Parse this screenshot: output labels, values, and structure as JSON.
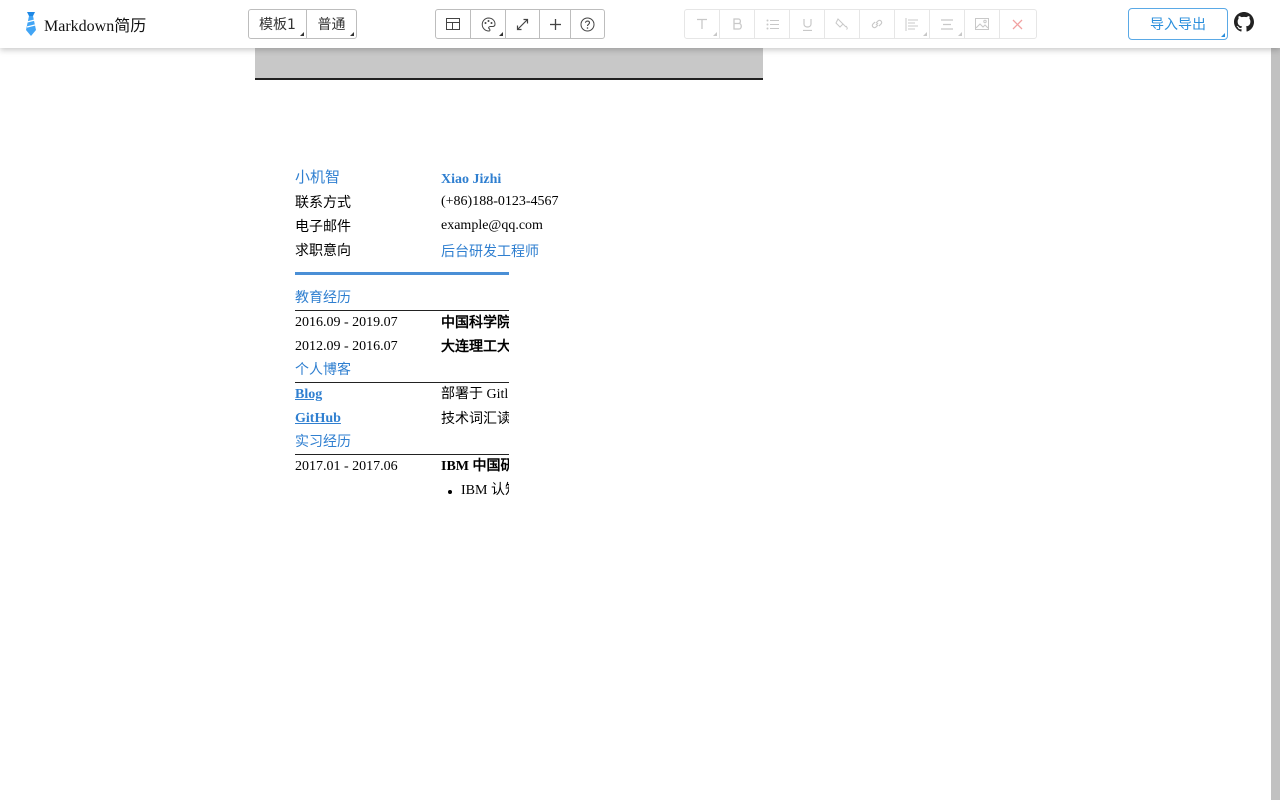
{
  "app": {
    "title": "Markdown简历"
  },
  "toolbar": {
    "template_button": "模板1",
    "mode_button": "普通",
    "view_icons": [
      "table-icon",
      "palette-icon",
      "expand-icon",
      "plus-icon",
      "help-icon"
    ],
    "format_icons": [
      "text-icon",
      "bold-icon",
      "list-icon",
      "underline-icon",
      "fill-icon",
      "link-icon",
      "align-left-icon",
      "align-center-icon",
      "image-icon",
      "close-icon"
    ],
    "export_button": "导入导出",
    "accent_color": "#2b8fdc"
  },
  "resume": {
    "name_cn": "小机智",
    "name_en": "Xiao Jizhi",
    "contact_label": "联系方式",
    "contact_value": "(+86)188-0123-4567",
    "email_label": "电子邮件",
    "email_value": "example@qq.com",
    "intent_label": "求职意向",
    "intent_value": "后台研发工程师",
    "education": {
      "heading": "教育经历",
      "items": [
        {
          "date": "2016.09 - 2019.07",
          "school": "中国科学院"
        },
        {
          "date": "2012.09 - 2016.07",
          "school": "大连理工大"
        }
      ]
    },
    "blog": {
      "heading": "个人博客",
      "items": [
        {
          "label": "Blog",
          "desc": "部署于 Gitl"
        },
        {
          "label": "GitHub",
          "desc": "技术词汇读"
        }
      ]
    },
    "internship": {
      "heading": "实习经历",
      "items": [
        {
          "date": "2017.01 - 2017.06",
          "company": "IBM 中国研",
          "bullets": [
            "IBM 认知"
          ]
        }
      ]
    },
    "accent_color": "#2f7fd0"
  }
}
